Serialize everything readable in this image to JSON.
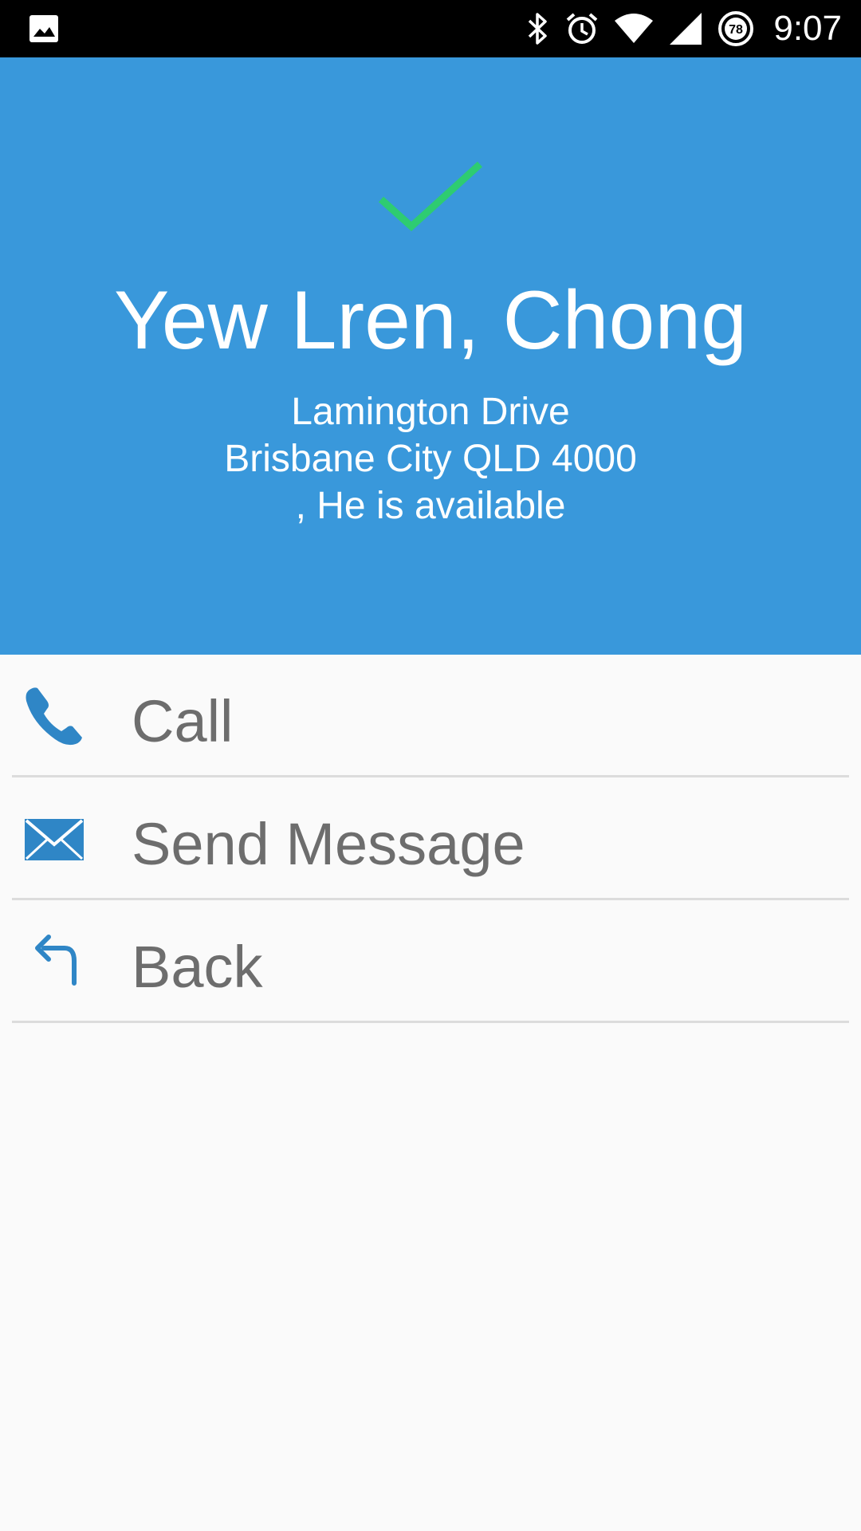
{
  "status_bar": {
    "time": "9:07",
    "battery_level": "78",
    "icons": [
      "image-icon",
      "bluetooth-icon",
      "alarm-icon",
      "wifi-icon",
      "cell-signal-icon",
      "battery-saver-icon"
    ]
  },
  "contact": {
    "status_icon": "check-icon",
    "name": "Yew Lren, Chong",
    "address_line1": "Lamington Drive",
    "address_line2": "Brisbane City QLD 4000",
    "availability": ", He is available"
  },
  "actions": [
    {
      "icon": "phone-icon",
      "label": "Call"
    },
    {
      "icon": "envelope-icon",
      "label": "Send Message"
    },
    {
      "icon": "back-arrow-icon",
      "label": "Back"
    }
  ],
  "colors": {
    "header_bg": "#3998db",
    "check": "#2ecc71",
    "icon_blue": "#2f86c6",
    "label_gray": "#6d6d6d",
    "divider": "#dcdcdc",
    "page_bg": "#fafafa"
  }
}
